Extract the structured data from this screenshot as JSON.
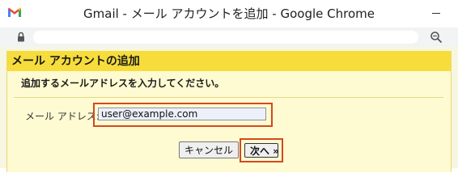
{
  "window": {
    "title": "Gmail - メール アカウントを追加 - Google Chrome",
    "app_icon": "gmail-icon"
  },
  "address_bar": {
    "lock_icon": "lock-icon",
    "url": "",
    "zoom_icon": "zoom-icon"
  },
  "dialog": {
    "title": "メール アカウントの追加",
    "instruction": "追加するメールアドレスを入力してください。",
    "email_label": "メール アドレス:",
    "email_value": "user@example.com",
    "cancel_label": "キャンセル",
    "next_label": "次へ »"
  },
  "colors": {
    "header_bg": "#f7dd3b",
    "dialog_bg": "#fefbd2",
    "highlight": "#d5481e"
  }
}
